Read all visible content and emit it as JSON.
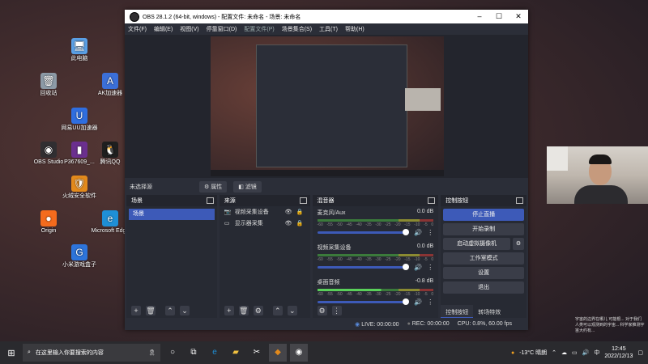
{
  "desktop": {
    "icons": [
      {
        "label": "此电脑",
        "glyph": "🖥",
        "color": "#5aa0e6"
      },
      {
        "label": "回收站",
        "glyph": "🗑",
        "color": "#8c9aa6"
      },
      {
        "label": "AK加速器",
        "glyph": "A",
        "color": "#3b6fd8"
      },
      {
        "label": "网易UU加速器",
        "glyph": "U",
        "color": "#2f6ee0"
      },
      {
        "label": "OBS Studio",
        "glyph": "◉",
        "color": "#302e31"
      },
      {
        "label": "P367609_...",
        "glyph": "▮",
        "color": "#6b2f8e"
      },
      {
        "label": "腾讯QQ",
        "glyph": "🐧",
        "color": "#1f1f1f"
      },
      {
        "label": "火绒安全软件",
        "glyph": "🛡",
        "color": "#e38a1c"
      },
      {
        "label": "Origin",
        "glyph": "●",
        "color": "#f46b1d"
      },
      {
        "label": "Microsoft Edge",
        "glyph": "e",
        "color": "#1f8fd6"
      },
      {
        "label": "小米游戏盒子",
        "glyph": "G",
        "color": "#2d74db"
      }
    ]
  },
  "obs": {
    "title": "OBS 28.1.2 (64-bit, windows) - 配置文件: 未命名 - 场景: 未命名",
    "menu": [
      "文件(F)",
      "编辑(E)",
      "视图(V)",
      "停靠窗口(D)",
      "配置文件(P)",
      "场景集合(S)",
      "工具(T)",
      "帮助(H)"
    ],
    "source_bar": {
      "no_source": "未选择源",
      "properties": "属性",
      "filters": "滤镜"
    },
    "scenes": {
      "title": "场景",
      "items": [
        "场景"
      ]
    },
    "sources": {
      "title": "来源",
      "items": [
        "视频采集设备",
        "显示器采集"
      ]
    },
    "mixer": {
      "title": "混音器",
      "channels": [
        {
          "name": "麦克风/Aux",
          "db": "0.0 dB",
          "lit": false
        },
        {
          "name": "视频采集设备",
          "db": "0.0 dB",
          "lit": false
        },
        {
          "name": "桌面音频",
          "db": "-0.8 dB",
          "lit": true
        }
      ],
      "ticks": [
        "-60",
        "-55",
        "-50",
        "-45",
        "-40",
        "-35",
        "-30",
        "-25",
        "-20",
        "-15",
        "-10",
        "-5",
        "0"
      ]
    },
    "controls": {
      "title": "控制按钮",
      "start_streaming": "停止直播",
      "start_recording": "开始录制",
      "virtual_camera": "启动虚拟摄像机",
      "studio_mode": "工作室模式",
      "settings": "设置",
      "exit": "退出",
      "tab_controls": "控制按钮",
      "tab_transitions": "转场特效"
    },
    "status": {
      "live": "LIVE: 00:00:00",
      "rec": "REC: 00:00:00",
      "cpu": "CPU: 0.8%, 60.00 fps"
    }
  },
  "watermark": "宇宙的边界在哪儿 可能根... 对于我们人类可以观测到的宇宙... 科学家推测宇宙大约有...",
  "taskbar": {
    "search_placeholder": "在这里输入你要搜索的内容",
    "weather": "-13°C 晴朗",
    "ime": "中",
    "time": "12:45",
    "date": "2022/12/13"
  }
}
